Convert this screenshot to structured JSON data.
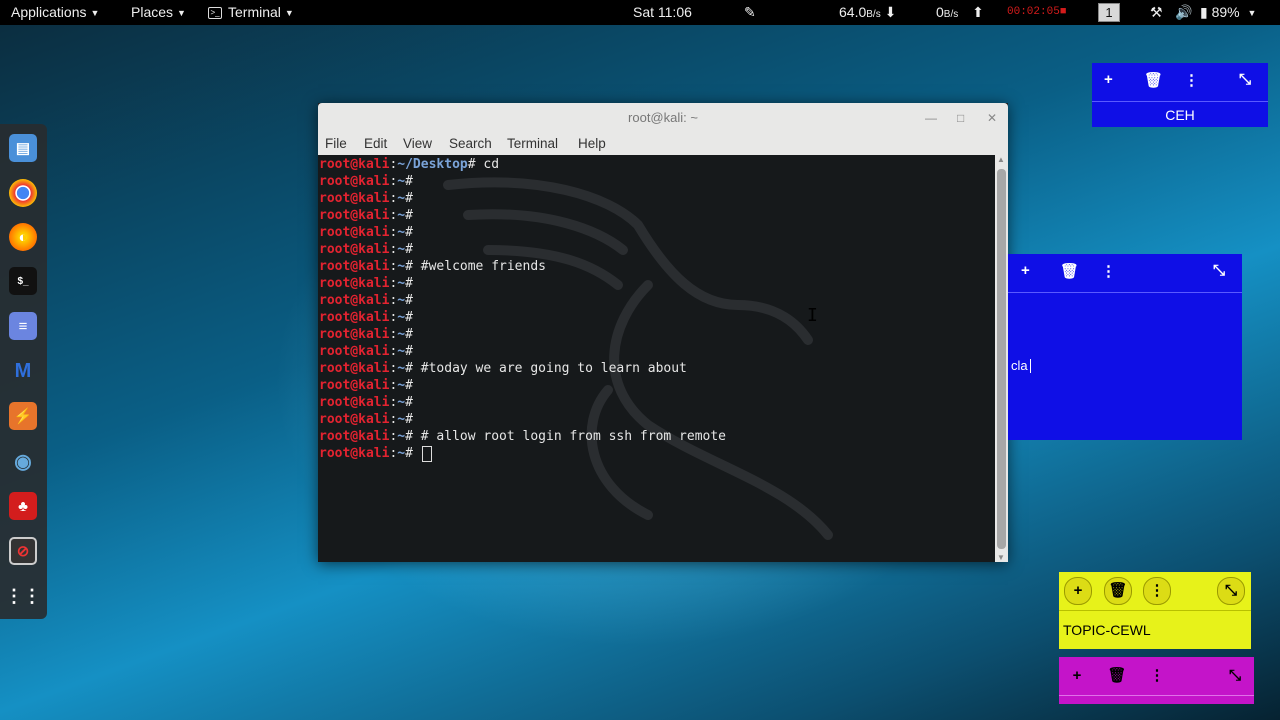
{
  "topbar": {
    "applications": "Applications",
    "places": "Places",
    "terminal": "Terminal",
    "clock": "Sat 11:06",
    "download_rate": "64.0",
    "download_unit": "B/s",
    "upload_rate": "0",
    "upload_unit": "B/s",
    "recording": "00:02:05",
    "workspace": "1",
    "battery": "89%"
  },
  "terminal": {
    "title": "root@kali: ~",
    "menu": [
      "File",
      "Edit",
      "View",
      "Search",
      "Terminal",
      "Help"
    ],
    "user": "root@kali",
    "desktop_path": "~/Desktop",
    "home_path": "~",
    "lines": [
      {
        "path": "desktop",
        "cmd": " cd"
      },
      {
        "path": "home",
        "cmd": ""
      },
      {
        "path": "home",
        "cmd": ""
      },
      {
        "path": "home",
        "cmd": ""
      },
      {
        "path": "home",
        "cmd": ""
      },
      {
        "path": "home",
        "cmd": ""
      },
      {
        "path": "home",
        "cmd": " #welcome friends"
      },
      {
        "path": "home",
        "cmd": ""
      },
      {
        "path": "home",
        "cmd": ""
      },
      {
        "path": "home",
        "cmd": ""
      },
      {
        "path": "home",
        "cmd": ""
      },
      {
        "path": "home",
        "cmd": ""
      },
      {
        "path": "home",
        "cmd": " #today we are going to learn about"
      },
      {
        "path": "home",
        "cmd": ""
      },
      {
        "path": "home",
        "cmd": ""
      },
      {
        "path": "home",
        "cmd": ""
      },
      {
        "path": "home",
        "cmd": " # allow root login from ssh from remote"
      },
      {
        "path": "home",
        "cmd": " ",
        "cursor": true
      }
    ]
  },
  "notes": {
    "ceh": {
      "text": "CEH",
      "color": "#0f0fe6"
    },
    "blue2": {
      "text": "cla",
      "color": "#0f0fe6"
    },
    "yellow": {
      "text": "TOPIC-CEWL",
      "color": "#e7f21a"
    },
    "magenta": {
      "text": "",
      "color": "#c414c9"
    }
  },
  "dock": [
    "files-icon",
    "chrome-icon",
    "firefox-icon",
    "terminal-icon",
    "text-editor-icon",
    "metasploit-icon",
    "burpsuite-icon",
    "eye-icon",
    "cherrytree-icon",
    "recorder-icon",
    "app-grid-icon"
  ]
}
